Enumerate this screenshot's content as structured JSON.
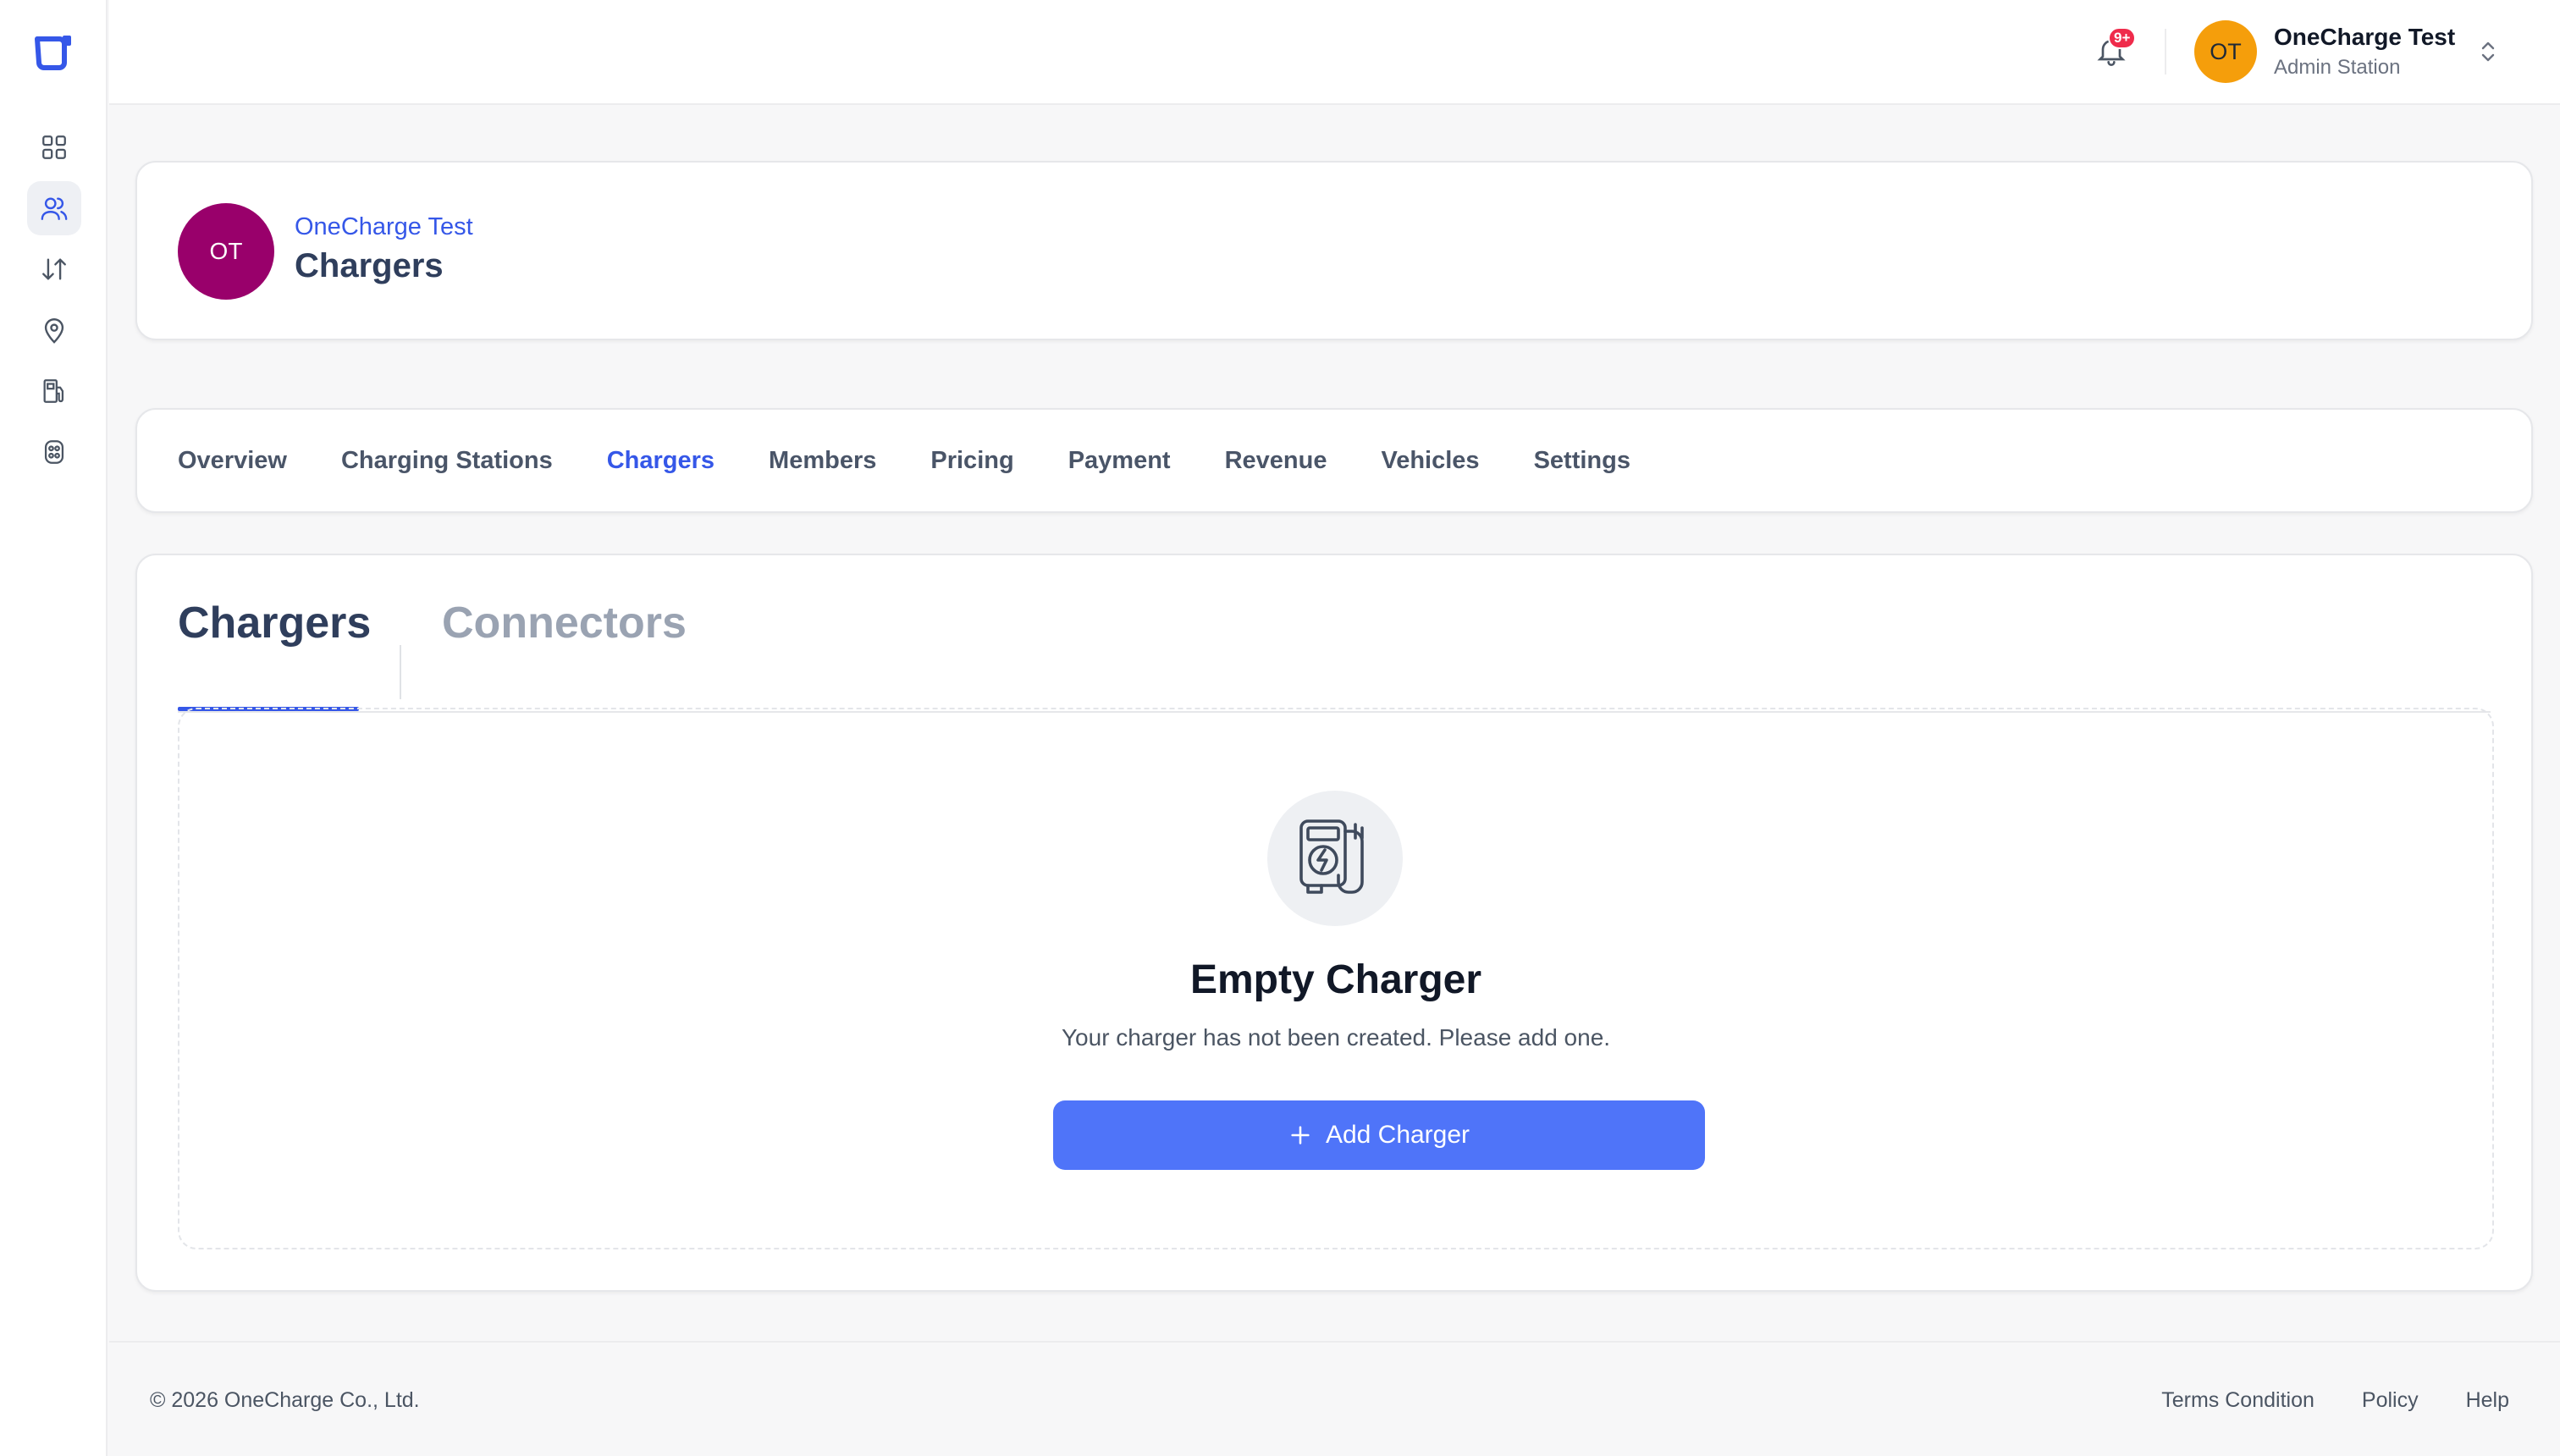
{
  "topbar": {
    "notification_badge": "9+",
    "user": {
      "initials": "OT",
      "name": "OneCharge Test",
      "role": "Admin Station"
    }
  },
  "header": {
    "avatar_initials": "OT",
    "org_name": "OneCharge Test",
    "title": "Chargers"
  },
  "nav": {
    "tabs": [
      {
        "label": "Overview",
        "active": false
      },
      {
        "label": "Charging Stations",
        "active": false
      },
      {
        "label": "Chargers",
        "active": true
      },
      {
        "label": "Members",
        "active": false
      },
      {
        "label": "Pricing",
        "active": false
      },
      {
        "label": "Payment",
        "active": false
      },
      {
        "label": "Revenue",
        "active": false
      },
      {
        "label": "Vehicles",
        "active": false
      },
      {
        "label": "Settings",
        "active": false
      }
    ]
  },
  "subtabs": {
    "chargers": "Chargers",
    "connectors": "Connectors"
  },
  "empty_state": {
    "icon": "charger-icon",
    "title": "Empty Charger",
    "description": "Your charger has not been created. Please add one.",
    "button_label": "Add Charger"
  },
  "sidebar": {
    "icons": [
      "dashboard-icon",
      "users-icon",
      "transfer-icon",
      "location-icon",
      "fuel-station-icon",
      "connector-icon"
    ],
    "active": "users-icon"
  },
  "footer": {
    "copyright": "© 2026 OneCharge Co., Ltd.",
    "links": [
      "Terms Condition",
      "Policy",
      "Help"
    ]
  },
  "colors": {
    "accent": "#3557e8",
    "button": "#4f74f9",
    "org_avatar": "#99006b",
    "user_avatar": "#f59e0b",
    "badge": "#ef2b4b"
  }
}
